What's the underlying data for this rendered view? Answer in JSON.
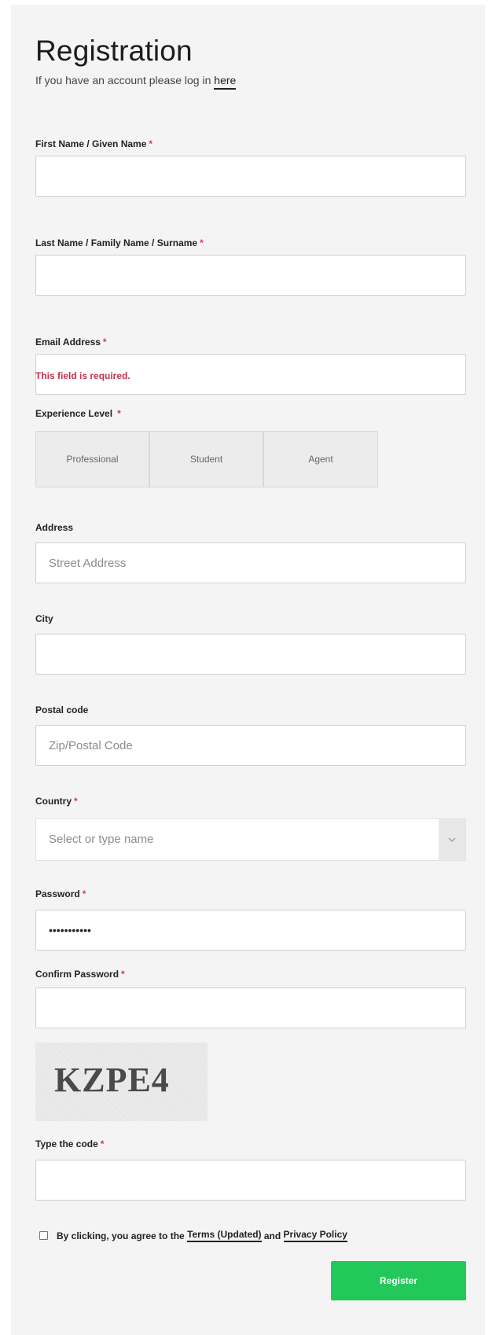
{
  "header": {
    "title": "Registration",
    "subtitle_prefix": "If you have an account please log in",
    "login_link": "here"
  },
  "fields": {
    "first_name": {
      "label": "First Name / Given Name",
      "required": "*",
      "value": ""
    },
    "last_name": {
      "label": "Last Name / Family Name / Surname",
      "required": "*",
      "value": ""
    },
    "email": {
      "label": "Email Address",
      "required": "*",
      "value": "",
      "error": "This field is required."
    },
    "experience": {
      "label": "Experience Level",
      "required": "*",
      "options": [
        "Professional",
        "Student",
        "Agent"
      ]
    },
    "address": {
      "label": "Address",
      "placeholder": "Street Address",
      "value": ""
    },
    "city": {
      "label": "City",
      "value": ""
    },
    "postal": {
      "label": "Postal code",
      "placeholder": "Zip/Postal Code",
      "value": ""
    },
    "country": {
      "label": "Country",
      "required": "*",
      "placeholder": "Select or type name"
    },
    "password": {
      "label": "Password",
      "required": "*",
      "value": "•••••••••••"
    },
    "confirm_password": {
      "label": "Confirm Password",
      "required": "*",
      "value": ""
    },
    "captcha": {
      "image_text": "KZPE4"
    },
    "code": {
      "label": "Type the code",
      "required": "*",
      "value": ""
    }
  },
  "terms": {
    "prefix": "By clicking, you agree to the",
    "terms_link": "Terms (Updated)",
    "and": "and",
    "privacy_link": "Privacy Policy",
    "checked": false
  },
  "register_button": "Register",
  "colors": {
    "accent_green": "#22c85a",
    "required_red": "#d9384d",
    "error_red": "#c4314b",
    "panel_bg": "#f4f4f4"
  }
}
